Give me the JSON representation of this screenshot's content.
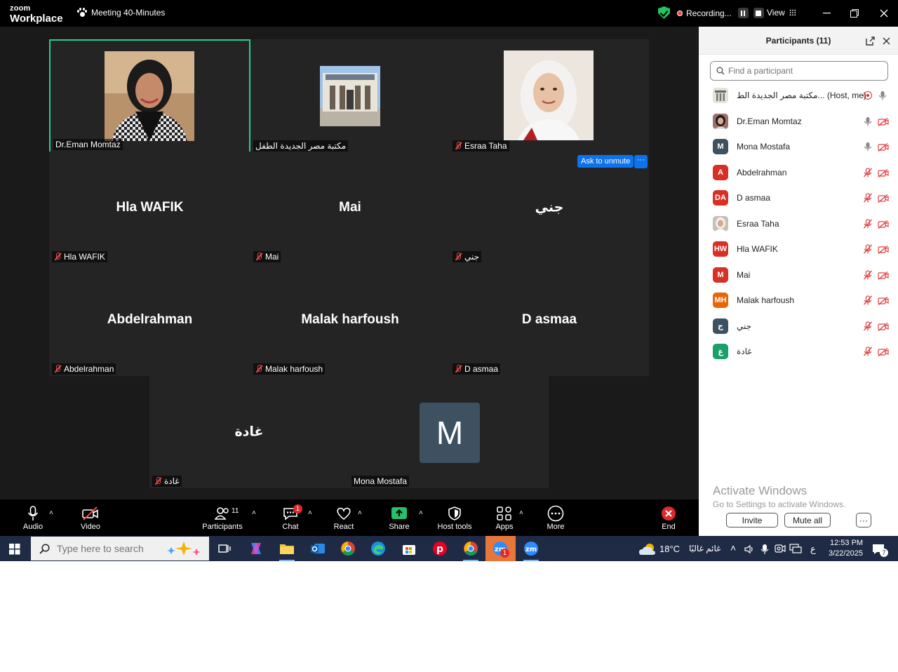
{
  "titlebar": {
    "brand_top": "zoom",
    "brand_bottom": "Workplace",
    "meeting_title": "Meeting 40-Minutes",
    "recording_label": "Recording...",
    "view_label": "View"
  },
  "tiles": [
    {
      "name": "Dr.Eman Momtaz",
      "label": "Dr.Eman Momtaz",
      "has_video": true,
      "muted": false,
      "active_speaker": true
    },
    {
      "name": "مكتبة مصر الجديدة الطفل",
      "label": "مكتبة مصر الجديدة الطفل",
      "has_video": true,
      "muted": false
    },
    {
      "name": "Esraa Taha",
      "label": "Esraa Taha",
      "has_video": true,
      "muted": true
    },
    {
      "name": "Hla  WAFIK",
      "label": "Hla  WAFIK",
      "muted": true
    },
    {
      "name": "Mai",
      "label": "Mai",
      "muted": true
    },
    {
      "name": "جني",
      "label": "جني",
      "muted": true
    },
    {
      "name": "Abdelrahman",
      "label": "Abdelrahman",
      "muted": true
    },
    {
      "name": "Malak harfoush",
      "label": "Malak harfoush",
      "muted": true
    },
    {
      "name": "D asmaa",
      "label": "D asmaa",
      "muted": true
    },
    {
      "name": "غادة",
      "label": "غادة",
      "muted": true
    },
    {
      "name": "Mona Mostafa",
      "label": "Mona Mostafa",
      "avatar_letter": "M",
      "muted": false
    }
  ],
  "ask_unmute_label": "Ask to unmute",
  "more_dots": "···",
  "toolbar": {
    "audio": "Audio",
    "video": "Video",
    "participants": "Participants",
    "participants_count": "11",
    "chat": "Chat",
    "chat_badge": "1",
    "react": "React",
    "share": "Share",
    "host_tools": "Host tools",
    "apps": "Apps",
    "more": "More",
    "end": "End"
  },
  "panel": {
    "title": "Participants (11)",
    "search_placeholder": "Find a participant",
    "participants": [
      {
        "name": "مكتبة مصر الجديدة الط... (Host, me)",
        "initials": "",
        "color": "#cfcfcf",
        "mic": "on",
        "video": "none"
      },
      {
        "name": "Dr.Eman Momtaz",
        "initials": "",
        "color": "#a0716a",
        "mic": "on",
        "video": "off"
      },
      {
        "name": "Mona Mostafa",
        "initials": "M",
        "color": "#3d5161",
        "mic": "on",
        "video": "off"
      },
      {
        "name": "Abdelrahman",
        "initials": "A",
        "color": "#d93025",
        "mic": "muted",
        "video": "off"
      },
      {
        "name": "D asmaa",
        "initials": "DA",
        "color": "#d93025",
        "mic": "muted",
        "video": "off"
      },
      {
        "name": "Esraa Taha",
        "initials": "",
        "color": "#c9bfb5",
        "mic": "muted",
        "video": "off"
      },
      {
        "name": "Hla  WAFIK",
        "initials": "HW",
        "color": "#d93025",
        "mic": "muted",
        "video": "off"
      },
      {
        "name": "Mai",
        "initials": "M",
        "color": "#d93025",
        "mic": "muted",
        "video": "off"
      },
      {
        "name": "Malak harfoush",
        "initials": "MH",
        "color": "#e8650a",
        "mic": "muted",
        "video": "off"
      },
      {
        "name": "جني",
        "initials": "ج",
        "color": "#3d5161",
        "mic": "muted",
        "video": "off"
      },
      {
        "name": "غادة",
        "initials": "غ",
        "color": "#1aa06b",
        "mic": "muted",
        "video": "off"
      }
    ],
    "watermark_title": "Activate Windows",
    "watermark_sub": "Go to Settings to activate Windows.",
    "invite": "Invite",
    "mute_all": "Mute all",
    "more": "···"
  },
  "taskbar": {
    "search_placeholder": "Type here to search",
    "weather_temp": "18°C",
    "weather_text": "غائم غالبًا",
    "lang": "ع",
    "time": "12:53 PM",
    "date": "3/22/2025",
    "notification_count": "7",
    "zoom_badge": "1"
  }
}
